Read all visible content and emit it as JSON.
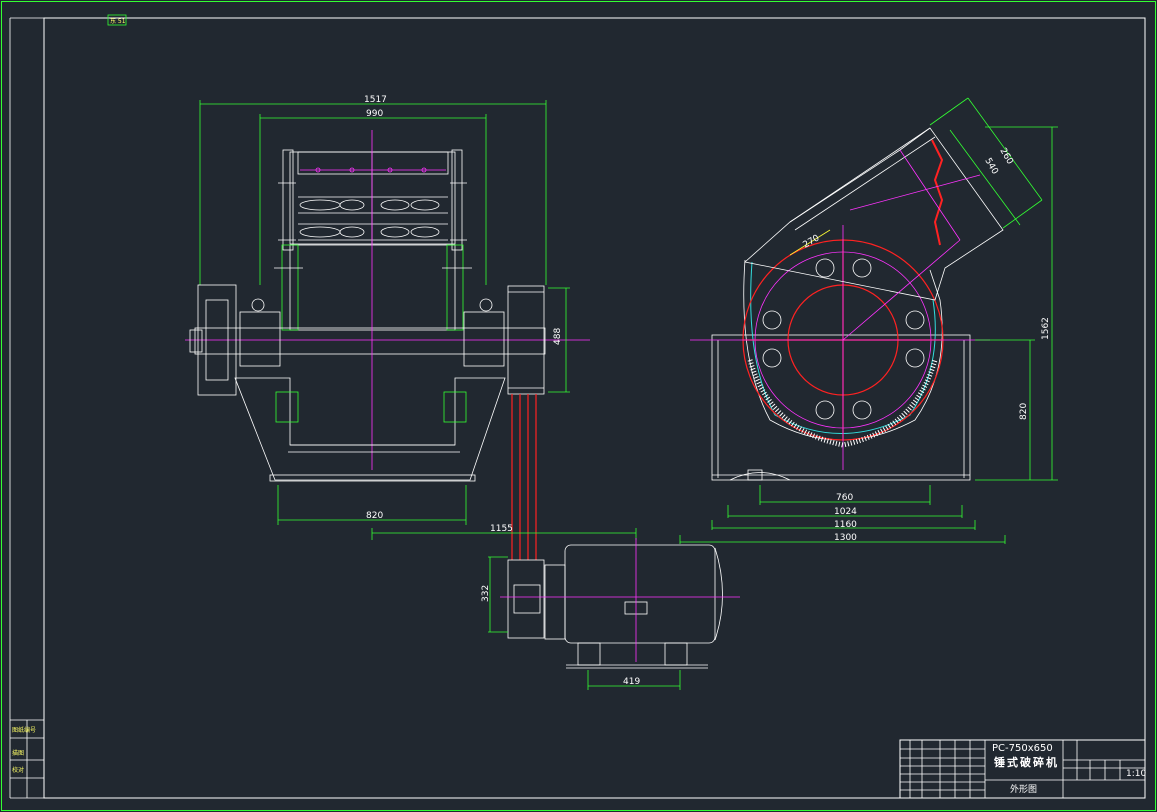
{
  "drawing": {
    "corner_mark": "东 51",
    "title_block": {
      "model": "PC-750x650",
      "name": "锤式破碎机",
      "sheet_label": "外形图",
      "scale": "1:10"
    },
    "left_stamps": [
      "图纸编号",
      "描图",
      "校对"
    ],
    "dimensions": {
      "front_total_width": "1517",
      "front_body_width": "990",
      "front_base_width": "820",
      "pulley_height": "488",
      "motor_offset": "1155",
      "motor_pulley_height": "332",
      "motor_foot_span": "419",
      "side_dim_260": "260",
      "side_dim_540": "540",
      "side_dim_270": "270",
      "side_height_total": "1562",
      "side_height_820": "820",
      "side_base_760": "760",
      "side_base_1024": "1024",
      "side_base_1160": "1160",
      "side_base_1300": "1300"
    }
  }
}
